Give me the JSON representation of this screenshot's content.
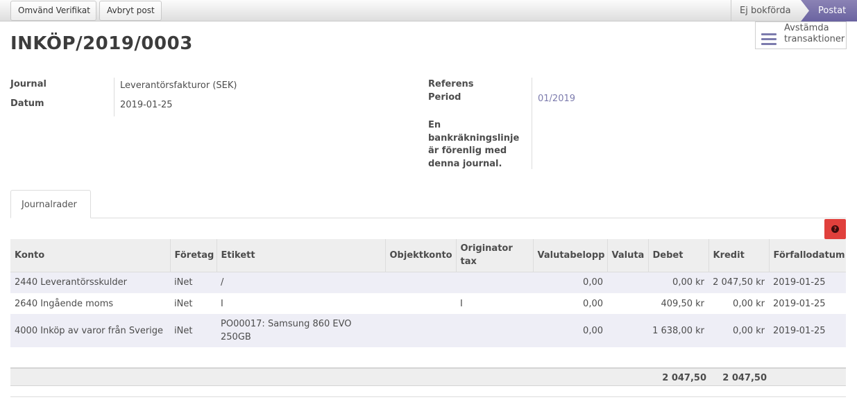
{
  "statusbar": {
    "reverse_button": "Omvänd Verifikat",
    "cancel_button": "Avbryt post",
    "state_draft": "Ej bokförda",
    "state_posted": "Postat"
  },
  "smart_button": {
    "line1": "Avstämda",
    "line2": "transaktioner"
  },
  "title": "INKÖP/2019/0003",
  "fields": {
    "journal_label": "Journal",
    "journal_value": "Leverantörsfakturor (SEK)",
    "date_label": "Datum",
    "date_value": "2019-01-25",
    "reference_label": "Referens",
    "period_label": "Period",
    "period_value": "01/2019",
    "bank_note": [
      "En",
      "bankräkningslinje",
      "är förenlig med",
      "denna journal."
    ]
  },
  "tab": {
    "label": "Journalrader"
  },
  "help_icon": "question-icon",
  "table": {
    "headers": {
      "konto": "Konto",
      "foretag": "Företag",
      "etikett": "Etikett",
      "objektkonto": "Objektkonto",
      "originator_1": "Originator",
      "originator_2": "tax",
      "valutabelopp": "Valutabelopp",
      "valuta": "Valuta",
      "debet": "Debet",
      "kredit": "Kredit",
      "forfallodatum": "Förfallodatum"
    },
    "rows": [
      {
        "konto": "2440 Leverantörsskulder",
        "foretag": "iNet",
        "etikett": "/",
        "objektkonto": "",
        "originator": "",
        "valutabelopp": "0,00",
        "valuta": "",
        "debet": "0,00 kr",
        "kredit": "2 047,50 kr",
        "forfallodatum": "2019-01-25"
      },
      {
        "konto": "2640 Ingående moms",
        "foretag": "iNet",
        "etikett": "I",
        "objektkonto": "",
        "originator": "I",
        "valutabelopp": "0,00",
        "valuta": "",
        "debet": "409,50 kr",
        "kredit": "0,00 kr",
        "forfallodatum": "2019-01-25"
      },
      {
        "konto": "4000 Inköp av varor från Sverige",
        "foretag": "iNet",
        "etikett": "PO00017: Samsung 860 EVO 250GB",
        "objektkonto": "",
        "originator": "",
        "valutabelopp": "0,00",
        "valuta": "",
        "debet": "1 638,00 kr",
        "kredit": "0,00 kr",
        "forfallodatum": "2019-01-25"
      }
    ],
    "totals": {
      "debet": "2 047,50",
      "kredit": "2 047,50"
    }
  },
  "colors": {
    "accent": "#7c7bad",
    "help_button": "#e0403c",
    "posted_state": "#7a73aa"
  }
}
